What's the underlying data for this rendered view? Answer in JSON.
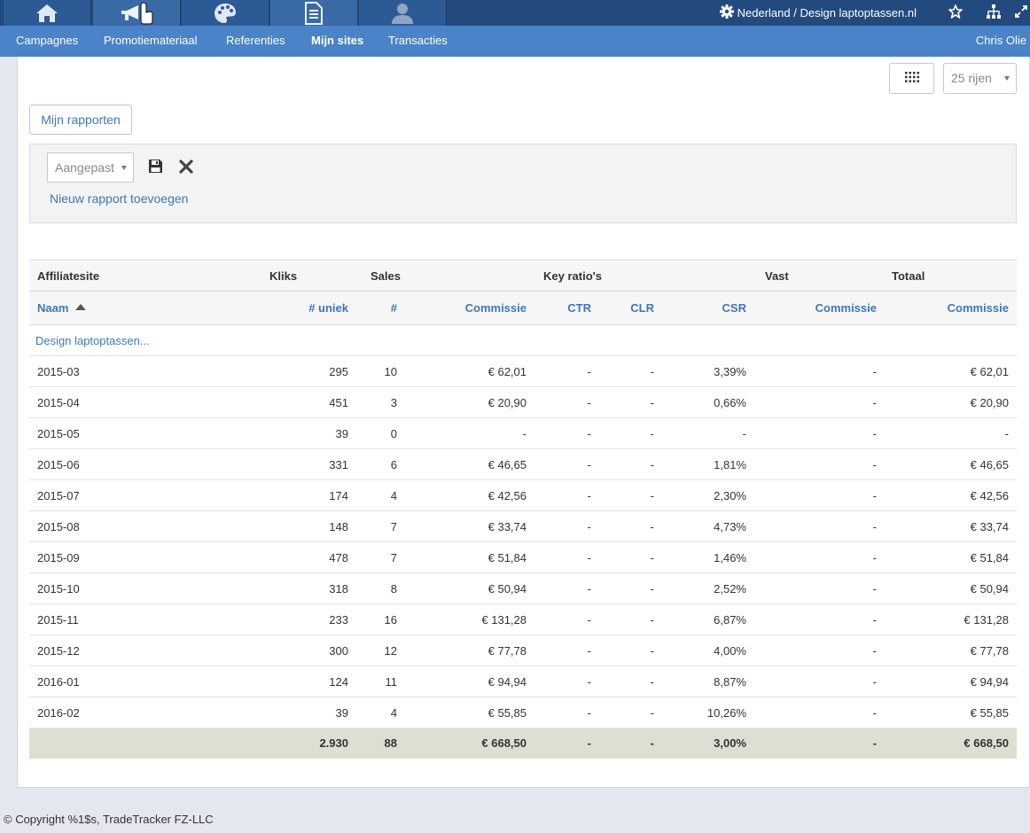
{
  "top_tabs": [
    {
      "name": "home",
      "icon": "home-icon"
    },
    {
      "name": "campaigns",
      "icon": "megaphone-icon"
    },
    {
      "name": "materials",
      "icon": "palette-icon"
    },
    {
      "name": "reports",
      "icon": "document-icon"
    },
    {
      "name": "account",
      "icon": "user-icon"
    }
  ],
  "site_switch": {
    "label": "Nederland / Design laptoptassen.nl",
    "icon": "gear-icon"
  },
  "top_right_icons": [
    "star-icon",
    "sitemap-icon",
    "expand-icon"
  ],
  "subnav": {
    "items": [
      "Campagnes",
      "Promotiemateriaal",
      "Referenties",
      "Mijn sites",
      "Transacties"
    ],
    "active": "Mijn sites",
    "user": "Chris Olie"
  },
  "toolbar": {
    "rows_label": "25 rijen",
    "grid_icon": "grid-icon"
  },
  "reports_button": "Mijn rapporten",
  "filter": {
    "select_value": "Aangepast",
    "save_icon": "save-icon",
    "remove_icon": "close-icon",
    "add_report_link": "Nieuw rapport toevoegen"
  },
  "table": {
    "group_headers": [
      "Affiliatesite",
      "Kliks",
      "Sales",
      "Key ratio's",
      "Vast",
      "Totaal"
    ],
    "columns": [
      "Naam",
      "# uniek",
      "#",
      "Commissie",
      "CTR",
      "CLR",
      "CSR",
      "Commissie",
      "Commissie"
    ],
    "site_name": "Design laptoptassen...",
    "rows": [
      [
        "2015-03",
        "295",
        "10",
        "€ 62,01",
        "-",
        "-",
        "3,39%",
        "-",
        "€ 62,01"
      ],
      [
        "2015-04",
        "451",
        "3",
        "€ 20,90",
        "-",
        "-",
        "0,66%",
        "-",
        "€ 20,90"
      ],
      [
        "2015-05",
        "39",
        "0",
        "-",
        "-",
        "-",
        "-",
        "-",
        "-"
      ],
      [
        "2015-06",
        "331",
        "6",
        "€ 46,65",
        "-",
        "-",
        "1,81%",
        "-",
        "€ 46,65"
      ],
      [
        "2015-07",
        "174",
        "4",
        "€ 42,56",
        "-",
        "-",
        "2,30%",
        "-",
        "€ 42,56"
      ],
      [
        "2015-08",
        "148",
        "7",
        "€ 33,74",
        "-",
        "-",
        "4,73%",
        "-",
        "€ 33,74"
      ],
      [
        "2015-09",
        "478",
        "7",
        "€ 51,84",
        "-",
        "-",
        "1,46%",
        "-",
        "€ 51,84"
      ],
      [
        "2015-10",
        "318",
        "8",
        "€ 50,94",
        "-",
        "-",
        "2,52%",
        "-",
        "€ 50,94"
      ],
      [
        "2015-11",
        "233",
        "16",
        "€ 131,28",
        "-",
        "-",
        "6,87%",
        "-",
        "€ 131,28"
      ],
      [
        "2015-12",
        "300",
        "12",
        "€ 77,78",
        "-",
        "-",
        "4,00%",
        "-",
        "€ 77,78"
      ],
      [
        "2016-01",
        "124",
        "11",
        "€ 94,94",
        "-",
        "-",
        "8,87%",
        "-",
        "€ 94,94"
      ],
      [
        "2016-02",
        "39",
        "4",
        "€ 55,85",
        "-",
        "-",
        "10,26%",
        "-",
        "€ 55,85"
      ]
    ],
    "totals": [
      "",
      "2.930",
      "88",
      "€ 668,50",
      "-",
      "-",
      "3,00%",
      "-",
      "€ 668,50"
    ]
  },
  "footer": "© Copyright %1$s, TradeTracker FZ-LLC",
  "colors": {
    "topbar": "#224a7d",
    "subnav": "#4a83c8",
    "link": "#3f77b6",
    "totals_bg": "#dedfd2"
  }
}
